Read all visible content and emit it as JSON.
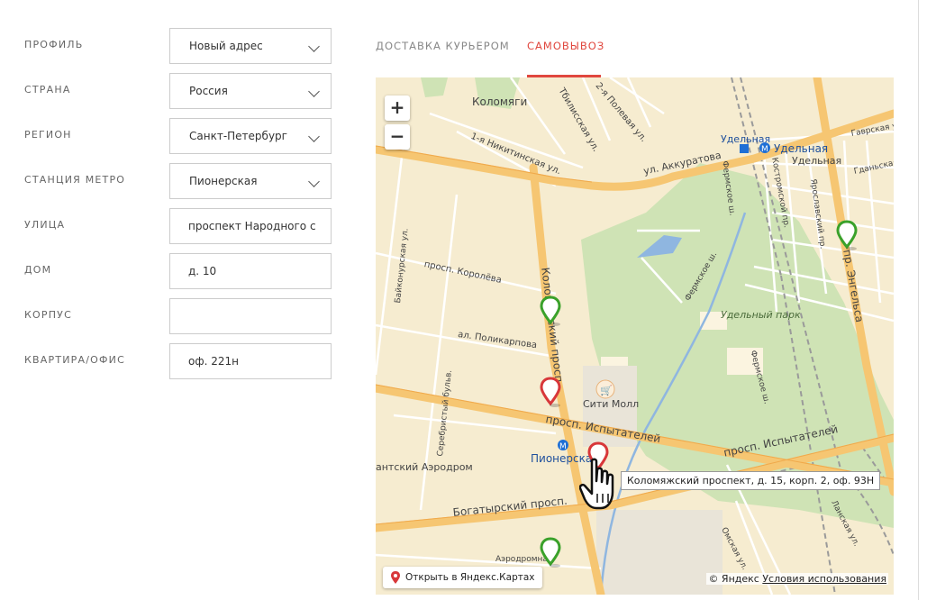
{
  "form": {
    "profile": {
      "label": "Профиль",
      "value": "Новый адрес"
    },
    "country": {
      "label": "Страна",
      "value": "Россия"
    },
    "region": {
      "label": "Регион",
      "value": "Санкт-Петербург"
    },
    "metro": {
      "label": "Станция метро",
      "value": "Пионерская"
    },
    "street": {
      "label": "Улица",
      "value": "проспект Народного с"
    },
    "house": {
      "label": "Дом",
      "value": "д. 10"
    },
    "building": {
      "label": "Корпус",
      "value": ""
    },
    "apartment": {
      "label": "Квартира/офис",
      "value": "оф. 221н"
    }
  },
  "tabs": [
    {
      "label": "ДОСТАВКА КУРЬЕРОМ"
    },
    {
      "label": "САМОВЫВОЗ"
    }
  ],
  "colors": {
    "accent": "#e0473e",
    "pin_green": "#3aa12a",
    "pin_red": "#d8373a"
  },
  "map": {
    "zoom_in": "+",
    "zoom_out": "−",
    "labels": {
      "kolomyagi": "Коломяги",
      "nikitinskaya": "1-я Никитинская ул.",
      "tbilisskaya": "Тбилисская ул.",
      "polevaya": "2-я Полевая ул.",
      "akkuratova": "ул. Аккуратова",
      "udelnaya1": "Удельная",
      "udelnaya2": "Удельная",
      "udelnaya3": "Удельная",
      "gavrskaya": "Гаврская ул.",
      "gdanskaya": "Гданьская ул.",
      "kostromskoy": "Костромской пр.",
      "yaroslavsky": "Ярославский пр.",
      "fermskoe": "Фермское ш.",
      "engelsa": "пр. Энгельса",
      "udelny_park": "Удельный парк",
      "korolyova": "просп. Королёва",
      "polikarpova": "ал. Поликарпова",
      "kolomyazhsky": "Коломяжский просп.",
      "serebristy": "Серебристый бульв.",
      "baykonurskaya": "Байконурская ул.",
      "city_mall": "Сити Молл",
      "ispytateley1": "просп. Испытателей",
      "ispytateley2": "просп. Испытателей",
      "pionerskaya": "Пионерская",
      "aerodrom": "антский Аэродром",
      "bogatyrsky": "Богатырский просп.",
      "aerodromnaya": "Аэродромная",
      "omskaya": "Омская ул.",
      "lanskaya": "Ланская ул."
    },
    "tooltip": "Коломяжский проспект, д. 15, корп. 2, оф. 93Н",
    "open_in_yandex": "Открыть в Яндекс.Картах",
    "copyright_prefix": "© Яндекс",
    "terms": "Условия использования"
  }
}
